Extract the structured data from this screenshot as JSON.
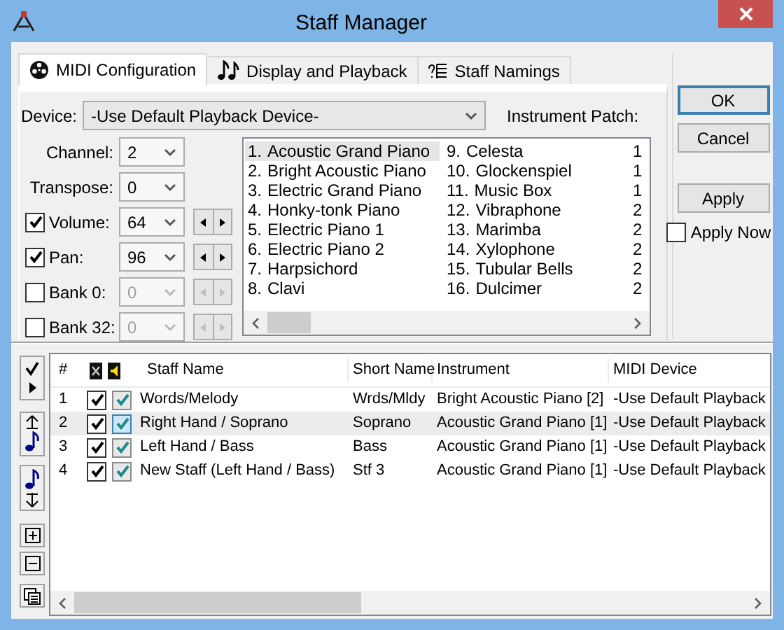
{
  "window": {
    "title": "Staff Manager"
  },
  "tabs": [
    {
      "label": "MIDI Configuration",
      "selected": true
    },
    {
      "label": "Display and Playback",
      "selected": false
    },
    {
      "label": "Staff Namings",
      "selected": false
    }
  ],
  "device": {
    "label": "Device:",
    "value": "-Use Default Playback Device-"
  },
  "settings": [
    {
      "kind": "plain",
      "label": "Channel:",
      "value": "2"
    },
    {
      "kind": "plain",
      "label": "Transpose:",
      "value": "0"
    },
    {
      "kind": "check",
      "label": "Volume:",
      "value": "64",
      "checked": true
    },
    {
      "kind": "check",
      "label": "Pan:",
      "value": "96",
      "checked": true
    },
    {
      "kind": "check",
      "label": "Bank 0:",
      "value": "0",
      "checked": false
    },
    {
      "kind": "check",
      "label": "Bank 32:",
      "value": "0",
      "checked": false
    }
  ],
  "instrument_patch": {
    "label": "Instrument Patch:",
    "items": [
      {
        "number": "1.",
        "name": "Acoustic Grand Piano",
        "selected": true
      },
      {
        "number": "2.",
        "name": "Bright Acoustic Piano",
        "selected": false
      },
      {
        "number": "3.",
        "name": "Electric Grand Piano",
        "selected": false
      },
      {
        "number": "4.",
        "name": "Honky-tonk Piano",
        "selected": false
      },
      {
        "number": "5.",
        "name": "Electric Piano 1",
        "selected": false
      },
      {
        "number": "6.",
        "name": "Electric Piano 2",
        "selected": false
      },
      {
        "number": "7.",
        "name": "Harpsichord",
        "selected": false
      },
      {
        "number": "8.",
        "name": "Clavi",
        "selected": false
      },
      {
        "number": "9.",
        "name": "Celesta",
        "selected": false
      },
      {
        "number": "10.",
        "name": "Glockenspiel",
        "selected": false
      },
      {
        "number": "11.",
        "name": "Music Box",
        "selected": false
      },
      {
        "number": "12.",
        "name": "Vibraphone",
        "selected": false
      },
      {
        "number": "13.",
        "name": "Marimba",
        "selected": false
      },
      {
        "number": "14.",
        "name": "Xylophone",
        "selected": false
      },
      {
        "number": "15.",
        "name": "Tubular Bells",
        "selected": false
      },
      {
        "number": "16.",
        "name": "Dulcimer",
        "selected": false
      }
    ],
    "column_3": [
      "1",
      "1",
      "1",
      "2",
      "2",
      "2",
      "2",
      "2"
    ]
  },
  "buttons": [
    {
      "label": "OK",
      "default": true
    },
    {
      "label": "Cancel",
      "default": false
    },
    {
      "label": "Apply",
      "default": false
    }
  ],
  "apply_now": {
    "label": "Apply Now",
    "checked": false
  },
  "staff_table": {
    "columns": {
      "number": "#",
      "staff_name": "Staff Name",
      "short_name": "Short Name",
      "instrument": "Instrument",
      "midi_device": "MIDI Device"
    },
    "rows": [
      {
        "number": "1",
        "visible": true,
        "playback": true,
        "staff_name": "Words/Melody",
        "short_name": "Wrds/Mldy",
        "instrument": "Bright Acoustic Piano [2]",
        "midi_device": "-Use Default Playback",
        "selected": false
      },
      {
        "number": "2",
        "visible": true,
        "playback": true,
        "staff_name": "Right Hand / Soprano",
        "short_name": "Soprano",
        "instrument": "Acoustic Grand Piano [1]",
        "midi_device": "-Use Default Playback",
        "selected": true
      },
      {
        "number": "3",
        "visible": true,
        "playback": true,
        "staff_name": "Left Hand / Bass",
        "short_name": "Bass",
        "instrument": "Acoustic Grand Piano [1]",
        "midi_device": "-Use Default Playback",
        "selected": false
      },
      {
        "number": "4",
        "visible": true,
        "playback": true,
        "staff_name": "New Staff (Left Hand / Bass)",
        "short_name": "Stf 3",
        "instrument": "Acoustic Grand Piano [1]",
        "midi_device": "-Use Default Playback",
        "selected": false
      }
    ]
  }
}
